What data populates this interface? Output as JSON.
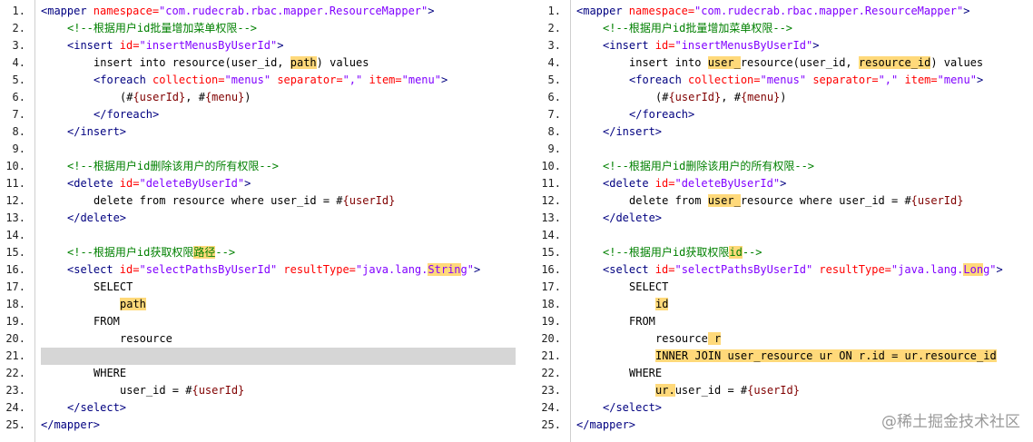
{
  "panes": [
    {
      "id": "left",
      "line_numbers": [
        "1.",
        "2.",
        "3.",
        "4.",
        "5.",
        "6.",
        "7.",
        "8.",
        "9.",
        "10.",
        "11.",
        "12.",
        "13.",
        "14.",
        "15.",
        "16.",
        "17.",
        "18.",
        "19.",
        "20.",
        "21.",
        "22.",
        "23.",
        "24.",
        "25."
      ],
      "lines": [
        {
          "indent": 0,
          "tokens": [
            {
              "t": "<mapper ",
              "c": "tag"
            },
            {
              "t": "namespace=",
              "c": "attr"
            },
            {
              "t": "\"com.rudecrab.rbac.mapper.ResourceMapper\"",
              "c": "val"
            },
            {
              "t": ">",
              "c": "tag"
            }
          ]
        },
        {
          "indent": 4,
          "tokens": [
            {
              "t": "<!--根据用户id批量增加菜单权限-->",
              "c": "com"
            }
          ]
        },
        {
          "indent": 4,
          "tokens": [
            {
              "t": "<insert ",
              "c": "tag"
            },
            {
              "t": "id=",
              "c": "attr"
            },
            {
              "t": "\"insertMenusByUserId\"",
              "c": "val"
            },
            {
              "t": ">",
              "c": "tag"
            }
          ]
        },
        {
          "indent": 8,
          "tokens": [
            {
              "t": "insert into resource(user_id, ",
              "c": "txt"
            },
            {
              "t": "path",
              "c": "txt",
              "hl": true
            },
            {
              "t": ") values",
              "c": "txt"
            }
          ]
        },
        {
          "indent": 8,
          "tokens": [
            {
              "t": "<foreach ",
              "c": "tag"
            },
            {
              "t": "collection=",
              "c": "attr"
            },
            {
              "t": "\"menus\"",
              "c": "val"
            },
            {
              "t": " separator=",
              "c": "attr"
            },
            {
              "t": "\",\"",
              "c": "val"
            },
            {
              "t": " item=",
              "c": "attr"
            },
            {
              "t": "\"menu\"",
              "c": "val"
            },
            {
              "t": ">",
              "c": "tag"
            }
          ]
        },
        {
          "indent": 12,
          "tokens": [
            {
              "t": "(#",
              "c": "txt"
            },
            {
              "t": "{userId}",
              "c": "var"
            },
            {
              "t": ", #",
              "c": "txt"
            },
            {
              "t": "{menu}",
              "c": "var"
            },
            {
              "t": ")",
              "c": "txt"
            }
          ]
        },
        {
          "indent": 8,
          "tokens": [
            {
              "t": "</foreach>",
              "c": "tag"
            }
          ]
        },
        {
          "indent": 4,
          "tokens": [
            {
              "t": "</insert>",
              "c": "tag"
            }
          ]
        },
        {
          "indent": 0,
          "tokens": []
        },
        {
          "indent": 4,
          "tokens": [
            {
              "t": "<!--根据用户id删除该用户的所有权限-->",
              "c": "com"
            }
          ]
        },
        {
          "indent": 4,
          "tokens": [
            {
              "t": "<delete ",
              "c": "tag"
            },
            {
              "t": "id=",
              "c": "attr"
            },
            {
              "t": "\"deleteByUserId\"",
              "c": "val"
            },
            {
              "t": ">",
              "c": "tag"
            }
          ]
        },
        {
          "indent": 8,
          "tokens": [
            {
              "t": "delete from resource where user_id = #",
              "c": "txt"
            },
            {
              "t": "{userId}",
              "c": "var"
            }
          ]
        },
        {
          "indent": 4,
          "tokens": [
            {
              "t": "</delete>",
              "c": "tag"
            }
          ]
        },
        {
          "indent": 0,
          "tokens": []
        },
        {
          "indent": 4,
          "tokens": [
            {
              "t": "<!--根据用户id获取权限",
              "c": "com"
            },
            {
              "t": "路径",
              "c": "com",
              "hl": true
            },
            {
              "t": "-->",
              "c": "com"
            }
          ]
        },
        {
          "indent": 4,
          "tokens": [
            {
              "t": "<select ",
              "c": "tag"
            },
            {
              "t": "id=",
              "c": "attr"
            },
            {
              "t": "\"selectPathsByUserId\"",
              "c": "val"
            },
            {
              "t": " resultType=",
              "c": "attr"
            },
            {
              "t": "\"java.lang.",
              "c": "val"
            },
            {
              "t": "Strin",
              "c": "val",
              "hl": true
            },
            {
              "t": "g\"",
              "c": "val"
            },
            {
              "t": ">",
              "c": "tag"
            }
          ]
        },
        {
          "indent": 8,
          "tokens": [
            {
              "t": "SELECT",
              "c": "txt"
            }
          ]
        },
        {
          "indent": 12,
          "tokens": [
            {
              "t": "path",
              "c": "txt",
              "hl": true
            }
          ]
        },
        {
          "indent": 8,
          "tokens": [
            {
              "t": "FROM",
              "c": "txt"
            }
          ]
        },
        {
          "indent": 12,
          "tokens": [
            {
              "t": "resource",
              "c": "txt"
            }
          ]
        },
        {
          "indent": 0,
          "tokens": [],
          "gray": true
        },
        {
          "indent": 8,
          "tokens": [
            {
              "t": "WHERE",
              "c": "txt"
            }
          ]
        },
        {
          "indent": 12,
          "tokens": [
            {
              "t": "user_id = #",
              "c": "txt"
            },
            {
              "t": "{userId}",
              "c": "var"
            }
          ]
        },
        {
          "indent": 4,
          "tokens": [
            {
              "t": "</select>",
              "c": "tag"
            }
          ]
        },
        {
          "indent": 0,
          "tokens": [
            {
              "t": "</mapper>",
              "c": "tag"
            }
          ]
        }
      ]
    },
    {
      "id": "right",
      "line_numbers": [
        "1.",
        "2.",
        "3.",
        "4.",
        "5.",
        "6.",
        "7.",
        "8.",
        "9.",
        "10.",
        "11.",
        "12.",
        "13.",
        "14.",
        "15.",
        "16.",
        "17.",
        "18.",
        "19.",
        "20.",
        "21.",
        "22.",
        "23.",
        "24.",
        "25."
      ],
      "lines": [
        {
          "indent": 0,
          "tokens": [
            {
              "t": "<mapper ",
              "c": "tag"
            },
            {
              "t": "namespace=",
              "c": "attr"
            },
            {
              "t": "\"com.rudecrab.rbac.mapper.ResourceMapper\"",
              "c": "val"
            },
            {
              "t": ">",
              "c": "tag"
            }
          ]
        },
        {
          "indent": 4,
          "tokens": [
            {
              "t": "<!--根据用户id批量增加菜单权限-->",
              "c": "com"
            }
          ]
        },
        {
          "indent": 4,
          "tokens": [
            {
              "t": "<insert ",
              "c": "tag"
            },
            {
              "t": "id=",
              "c": "attr"
            },
            {
              "t": "\"insertMenusByUserId\"",
              "c": "val"
            },
            {
              "t": ">",
              "c": "tag"
            }
          ]
        },
        {
          "indent": 8,
          "tokens": [
            {
              "t": "insert into ",
              "c": "txt"
            },
            {
              "t": "user_",
              "c": "txt",
              "hl": true
            },
            {
              "t": "resource(user_id, ",
              "c": "txt"
            },
            {
              "t": "resource_id",
              "c": "txt",
              "hl": true
            },
            {
              "t": ") values",
              "c": "txt"
            }
          ]
        },
        {
          "indent": 8,
          "tokens": [
            {
              "t": "<foreach ",
              "c": "tag"
            },
            {
              "t": "collection=",
              "c": "attr"
            },
            {
              "t": "\"menus\"",
              "c": "val"
            },
            {
              "t": " separator=",
              "c": "attr"
            },
            {
              "t": "\",\"",
              "c": "val"
            },
            {
              "t": " item=",
              "c": "attr"
            },
            {
              "t": "\"menu\"",
              "c": "val"
            },
            {
              "t": ">",
              "c": "tag"
            }
          ]
        },
        {
          "indent": 12,
          "tokens": [
            {
              "t": "(#",
              "c": "txt"
            },
            {
              "t": "{userId}",
              "c": "var"
            },
            {
              "t": ", #",
              "c": "txt"
            },
            {
              "t": "{menu}",
              "c": "var"
            },
            {
              "t": ")",
              "c": "txt"
            }
          ]
        },
        {
          "indent": 8,
          "tokens": [
            {
              "t": "</foreach>",
              "c": "tag"
            }
          ]
        },
        {
          "indent": 4,
          "tokens": [
            {
              "t": "</insert>",
              "c": "tag"
            }
          ]
        },
        {
          "indent": 0,
          "tokens": []
        },
        {
          "indent": 4,
          "tokens": [
            {
              "t": "<!--根据用户id删除该用户的所有权限-->",
              "c": "com"
            }
          ]
        },
        {
          "indent": 4,
          "tokens": [
            {
              "t": "<delete ",
              "c": "tag"
            },
            {
              "t": "id=",
              "c": "attr"
            },
            {
              "t": "\"deleteByUserId\"",
              "c": "val"
            },
            {
              "t": ">",
              "c": "tag"
            }
          ]
        },
        {
          "indent": 8,
          "tokens": [
            {
              "t": "delete from ",
              "c": "txt"
            },
            {
              "t": "user_",
              "c": "txt",
              "hl": true
            },
            {
              "t": "resource where user_id = #",
              "c": "txt"
            },
            {
              "t": "{userId}",
              "c": "var"
            }
          ]
        },
        {
          "indent": 4,
          "tokens": [
            {
              "t": "</delete>",
              "c": "tag"
            }
          ]
        },
        {
          "indent": 0,
          "tokens": []
        },
        {
          "indent": 4,
          "tokens": [
            {
              "t": "<!--根据用户id获取权限",
              "c": "com"
            },
            {
              "t": "id",
              "c": "com",
              "hl": true
            },
            {
              "t": "-->",
              "c": "com"
            }
          ]
        },
        {
          "indent": 4,
          "tokens": [
            {
              "t": "<select ",
              "c": "tag"
            },
            {
              "t": "id=",
              "c": "attr"
            },
            {
              "t": "\"selectPathsByUserId\"",
              "c": "val"
            },
            {
              "t": " resultType=",
              "c": "attr"
            },
            {
              "t": "\"java.lang.",
              "c": "val"
            },
            {
              "t": "Lon",
              "c": "val",
              "hl": true
            },
            {
              "t": "g\"",
              "c": "val"
            },
            {
              "t": ">",
              "c": "tag"
            }
          ]
        },
        {
          "indent": 8,
          "tokens": [
            {
              "t": "SELECT",
              "c": "txt"
            }
          ]
        },
        {
          "indent": 12,
          "tokens": [
            {
              "t": "id",
              "c": "txt",
              "hl": true
            }
          ]
        },
        {
          "indent": 8,
          "tokens": [
            {
              "t": "FROM",
              "c": "txt"
            }
          ]
        },
        {
          "indent": 12,
          "tokens": [
            {
              "t": "resource",
              "c": "txt"
            },
            {
              "t": " r",
              "c": "txt",
              "hl": true
            }
          ]
        },
        {
          "indent": 12,
          "tokens": [
            {
              "t": "INNER JOIN user_resource ur ON r.id = ur.resource_id",
              "c": "txt",
              "hl": true
            }
          ]
        },
        {
          "indent": 8,
          "tokens": [
            {
              "t": "WHERE",
              "c": "txt"
            }
          ]
        },
        {
          "indent": 12,
          "tokens": [
            {
              "t": "ur.",
              "c": "txt",
              "hl": true
            },
            {
              "t": "user_id = #",
              "c": "txt"
            },
            {
              "t": "{userId}",
              "c": "var"
            }
          ]
        },
        {
          "indent": 4,
          "tokens": [
            {
              "t": "</select>",
              "c": "tag"
            }
          ]
        },
        {
          "indent": 0,
          "tokens": [
            {
              "t": "</mapper>",
              "c": "tag"
            }
          ]
        }
      ]
    }
  ],
  "watermark": "@稀土掘金技术社区",
  "colors": {
    "tag": "#000080",
    "attr": "#ff0000",
    "value": "#8000ff",
    "comment": "#008000",
    "variable": "#800000",
    "highlight": "#ffd97a",
    "removed_line": "#d6d6d6"
  }
}
